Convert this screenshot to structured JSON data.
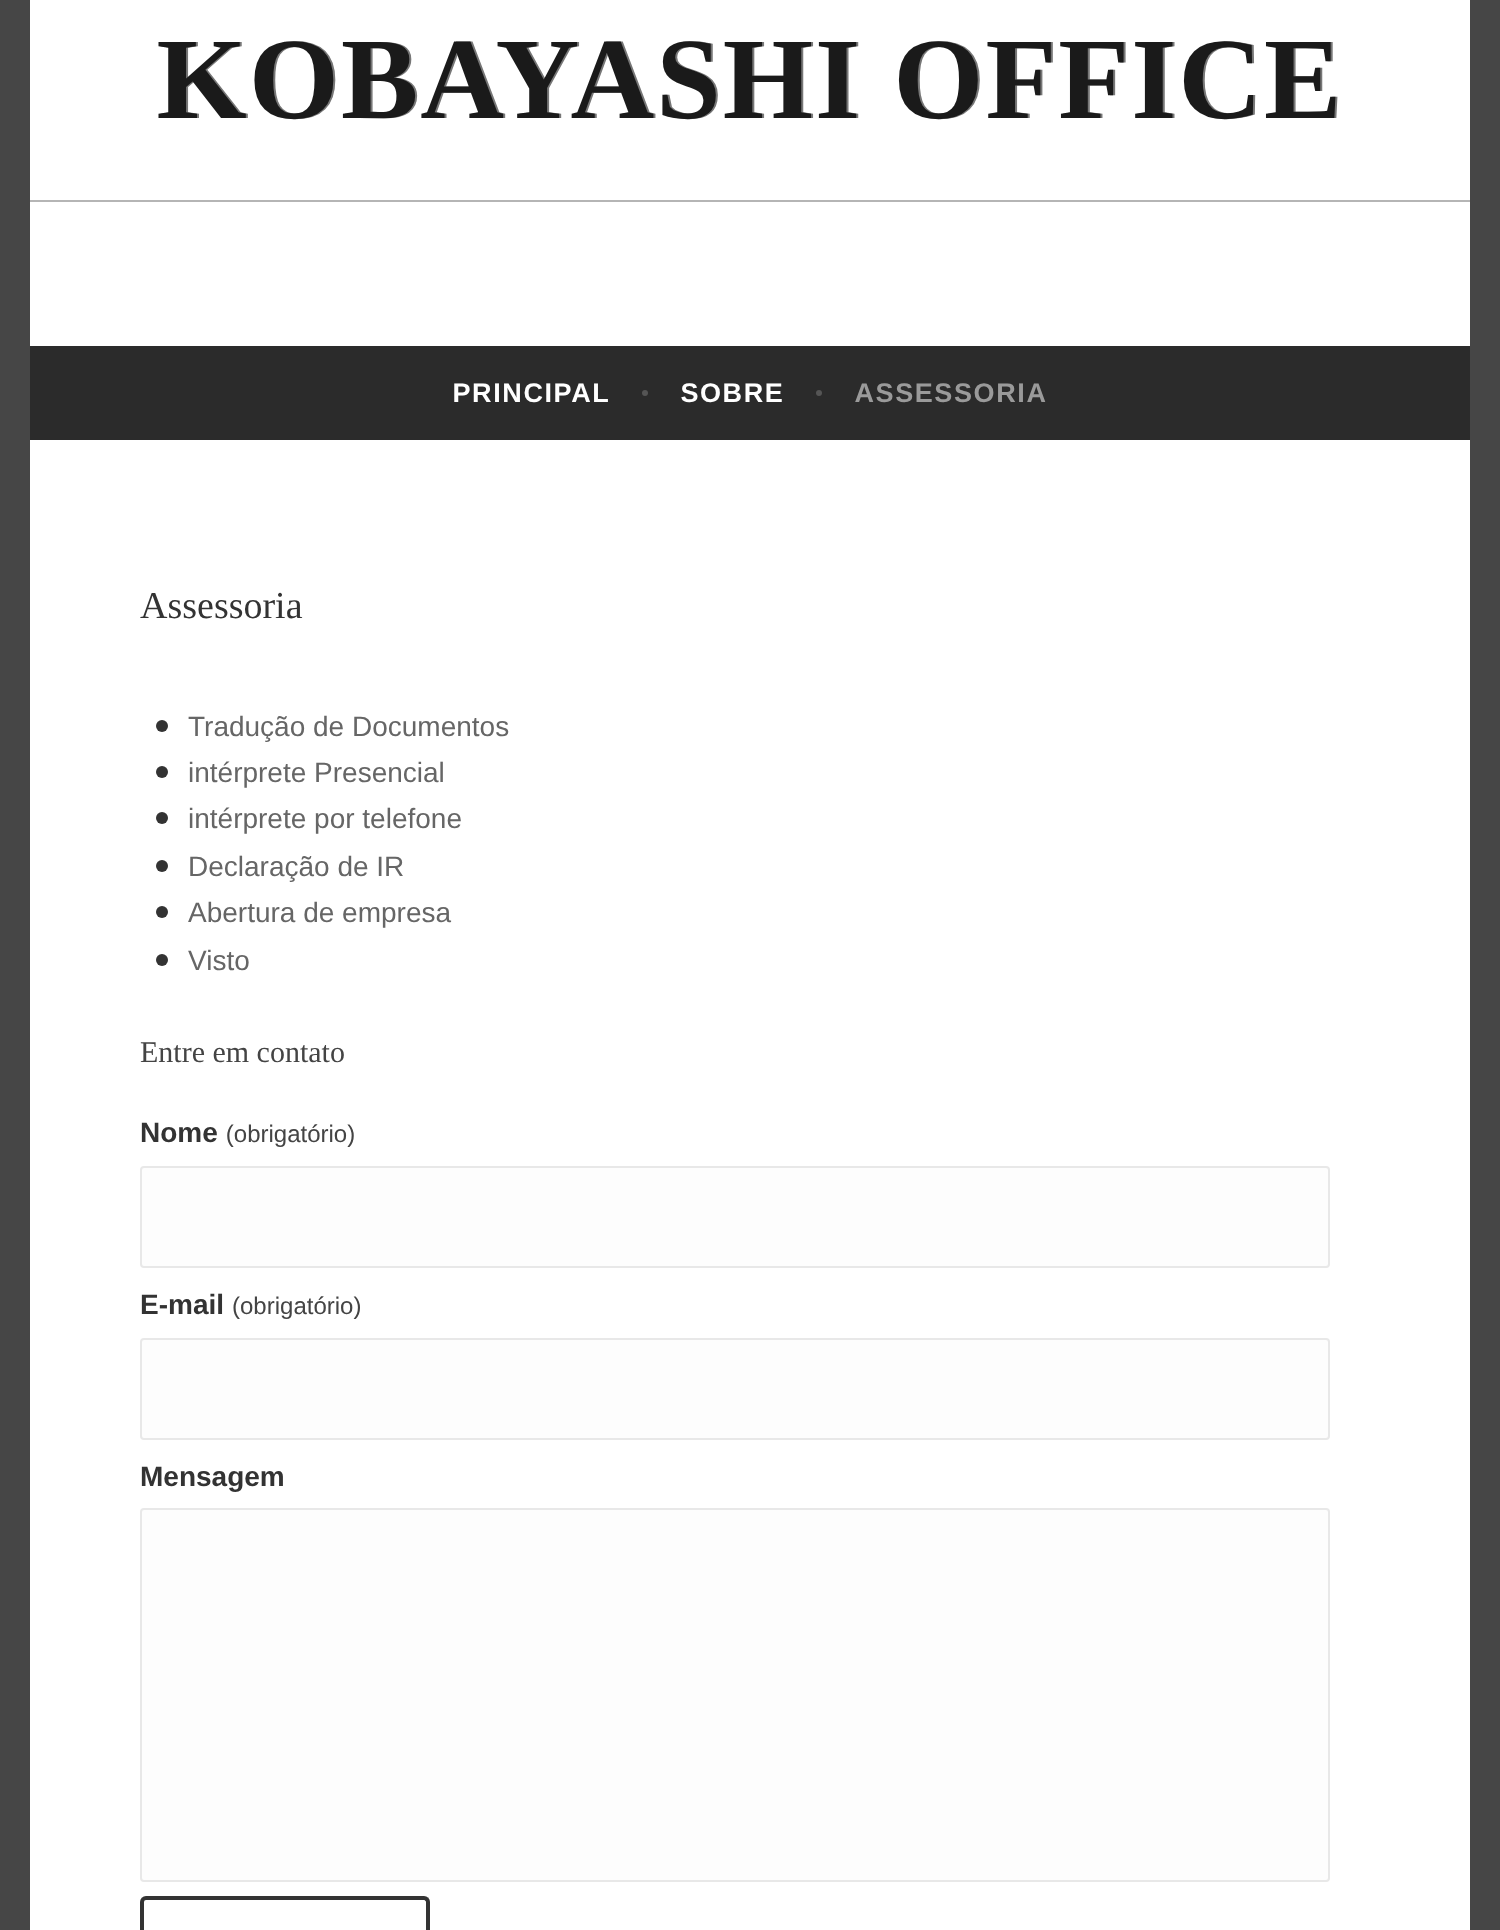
{
  "header": {
    "logo": "KOBAYASHI OFFICE"
  },
  "nav": {
    "items": [
      {
        "label": "PRINCIPAL",
        "selected": false
      },
      {
        "label": "SOBRE",
        "selected": false
      },
      {
        "label": "ASSESSORIA",
        "selected": true
      }
    ]
  },
  "page": {
    "title": "Assessoria",
    "services": [
      "Tradução de Documentos",
      "intérprete Presencial",
      "intérprete por telefone",
      "Declaração de IR",
      "Abertura de empresa",
      "Visto"
    ]
  },
  "contact": {
    "heading": "Entre em contato",
    "fields": [
      {
        "kind": "input",
        "label": "Nome",
        "note": "(obrigatório)"
      },
      {
        "kind": "input",
        "label": "E-mail",
        "note": "(obrigatório)"
      },
      {
        "kind": "textarea",
        "label": "Mensagem"
      }
    ]
  }
}
